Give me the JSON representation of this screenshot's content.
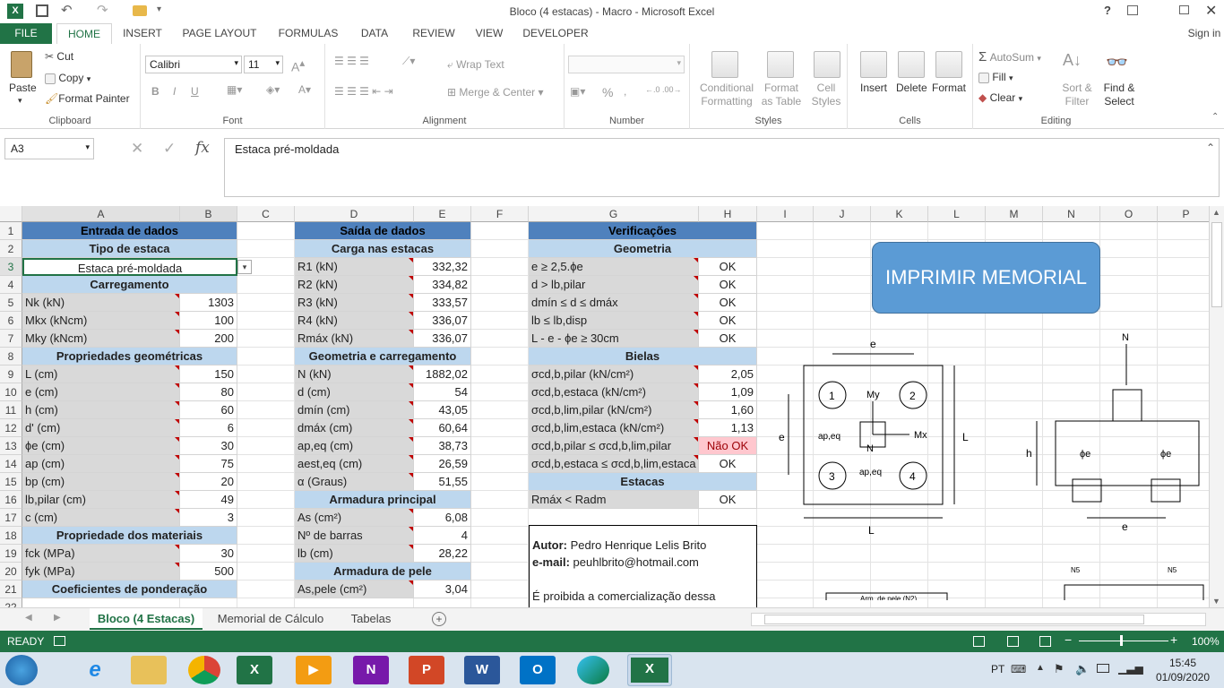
{
  "window": {
    "title": "Bloco (4 estacas) - Macro - Microsoft Excel",
    "help": "?",
    "signin": "Sign in"
  },
  "ribbon_tabs": [
    "FILE",
    "HOME",
    "INSERT",
    "PAGE LAYOUT",
    "FORMULAS",
    "DATA",
    "REVIEW",
    "VIEW",
    "DEVELOPER"
  ],
  "clipboard": {
    "paste": "Paste",
    "cut": "Cut",
    "copy": "Copy",
    "format_painter": "Format Painter",
    "label": "Clipboard"
  },
  "font": {
    "name": "Calibri",
    "size": "11",
    "label": "Font",
    "bold": "B",
    "italic": "I",
    "underline": "U"
  },
  "alignment": {
    "wrap": "Wrap Text",
    "merge": "Merge & Center",
    "label": "Alignment"
  },
  "number": {
    "label": "Number",
    "percent": "%"
  },
  "styles": {
    "cond": "Conditional Formatting",
    "table": "Format as Table",
    "cell": "Cell Styles",
    "label": "Styles"
  },
  "cells": {
    "insert": "Insert",
    "delete": "Delete",
    "format": "Format",
    "label": "Cells"
  },
  "editing": {
    "autosum": "AutoSum",
    "fill": "Fill",
    "clear": "Clear",
    "sort": "Sort & Filter",
    "find": "Find & Select",
    "label": "Editing"
  },
  "formula_bar": {
    "name_box": "A3",
    "fx": "fx",
    "content": "Estaca pré-moldada"
  },
  "columns": [
    "A",
    "B",
    "C",
    "D",
    "E",
    "F",
    "G",
    "H",
    "I",
    "J",
    "K",
    "L",
    "M",
    "N",
    "O",
    "P"
  ],
  "rows": [
    "1",
    "2",
    "3",
    "4",
    "5",
    "6",
    "7",
    "8",
    "9",
    "10",
    "11",
    "12",
    "13",
    "14",
    "15",
    "16",
    "17",
    "18",
    "19",
    "20",
    "21",
    "22"
  ],
  "entrada": {
    "title": "Entrada de dados",
    "tipo": "Tipo de estaca",
    "tipo_val": "Estaca pré-moldada",
    "carregamento": "Carregamento",
    "carga": [
      [
        "Nk (kN)",
        "1303"
      ],
      [
        "Mkx (kNcm)",
        "100"
      ],
      [
        "Mky (kNcm)",
        "200"
      ]
    ],
    "geom_title": "Propriedades geométricas",
    "geom": [
      [
        "L (cm)",
        "150"
      ],
      [
        "e (cm)",
        "80"
      ],
      [
        "h (cm)",
        "60"
      ],
      [
        "d' (cm)",
        "6"
      ],
      [
        "ϕe (cm)",
        "30"
      ],
      [
        "ap (cm)",
        "75"
      ],
      [
        "bp (cm)",
        "20"
      ],
      [
        "lb,pilar (cm)",
        "49"
      ],
      [
        "c (cm)",
        "3"
      ]
    ],
    "mat_title": "Propriedade dos materiais",
    "mat": [
      [
        "fck (MPa)",
        "30"
      ],
      [
        "fyk (MPa)",
        "500"
      ]
    ],
    "coef_title": "Coeficientes de ponderação"
  },
  "saida": {
    "title": "Saída de dados",
    "carga_title": "Carga nas estacas",
    "carga": [
      [
        "R1 (kN)",
        "332,32"
      ],
      [
        "R2 (kN)",
        "334,82"
      ],
      [
        "R3 (kN)",
        "333,57"
      ],
      [
        "R4 (kN)",
        "336,07"
      ],
      [
        "Rmáx (kN)",
        "336,07"
      ]
    ],
    "geom_title": "Geometria e carregamento",
    "geom": [
      [
        "N (kN)",
        "1882,02"
      ],
      [
        "d (cm)",
        "54"
      ],
      [
        "dmín (cm)",
        "43,05"
      ],
      [
        "dmáx (cm)",
        "60,64"
      ],
      [
        "ap,eq (cm)",
        "38,73"
      ],
      [
        "aest,eq (cm)",
        "26,59"
      ],
      [
        "α (Graus)",
        "51,55"
      ]
    ],
    "arm_title": "Armadura principal",
    "arm": [
      [
        "As (cm²)",
        "6,08"
      ],
      [
        "Nº de barras",
        "4"
      ],
      [
        "lb (cm)",
        "28,22"
      ]
    ],
    "pele_title": "Armadura de pele",
    "pele": [
      [
        "As,pele (cm²)",
        "3,04"
      ]
    ]
  },
  "verif": {
    "title": "Verificações",
    "geom_title": "Geometria",
    "geom": [
      [
        "e ≥ 2,5.ϕe",
        "OK"
      ],
      [
        "d > lb,pilar",
        "OK"
      ],
      [
        "dmín ≤ d ≤ dmáx",
        "OK"
      ],
      [
        "lb ≤ lb,disp",
        "OK"
      ],
      [
        "L - e - ϕe ≥ 30cm",
        "OK"
      ]
    ],
    "bielas_title": "Bielas",
    "bielas": [
      [
        "σcd,b,pilar (kN/cm²)",
        "2,05"
      ],
      [
        "σcd,b,estaca (kN/cm²)",
        "1,09"
      ],
      [
        "σcd,b,lim,pilar (kN/cm²)",
        "1,60"
      ],
      [
        "σcd,b,lim,estaca (kN/cm²)",
        "1,13"
      ],
      [
        "σcd,b,pilar ≤ σcd,b,lim,pilar",
        "Não OK"
      ],
      [
        "σcd,b,estaca ≤ σcd,b,lim,estaca",
        "OK"
      ]
    ],
    "estacas_title": "Estacas",
    "estacas": [
      [
        "Rmáx < Radm",
        "OK"
      ]
    ]
  },
  "author": {
    "autor_label": "Autor:",
    "autor": " Pedro Henrique Lelis Brito",
    "email_label": "e-mail:",
    "email": " peuhlbrito@hotmail.com",
    "note": "É proibida a comercialização dessa planilha"
  },
  "button": {
    "label": "IMPRIMIR MEMORIAL"
  },
  "drawing": {
    "e": "e",
    "L": "L",
    "h": "h",
    "N": "N",
    "My": "My",
    "Mx": "Mx",
    "ap_eq": "ap,eq",
    "phi": "ϕe",
    "p1": "1",
    "p2": "2",
    "p3": "3",
    "p4": "4",
    "pele": "Arm. de pele (N2)",
    "n5": "N5"
  },
  "sheets": [
    "Bloco (4 Estacas)",
    "Memorial de Cálculo",
    "Tabelas"
  ],
  "status": {
    "ready": "READY",
    "zoom": "100%"
  },
  "taskbar": {
    "lang": "PT",
    "time": "15:45",
    "date": "01/09/2020"
  }
}
